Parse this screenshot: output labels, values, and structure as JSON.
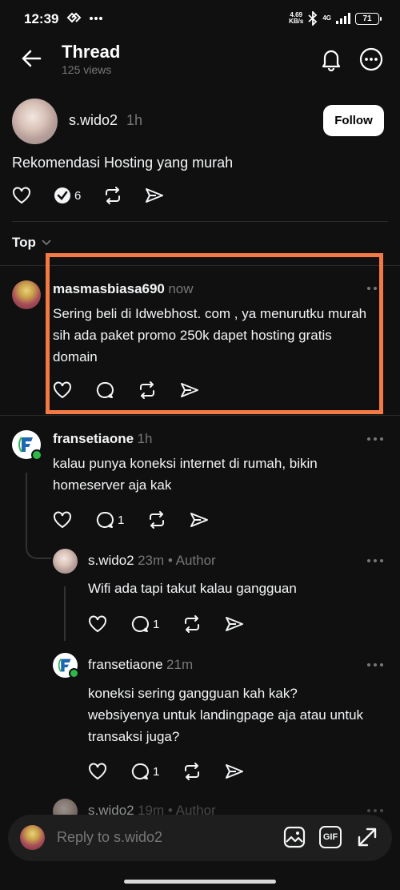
{
  "status_bar": {
    "time": "12:39",
    "net_speed_value": "4.69",
    "net_speed_unit": "KB/s",
    "network": "4G",
    "battery": "71"
  },
  "header": {
    "title": "Thread",
    "views": "125 views"
  },
  "post": {
    "username": "s.wido2",
    "time": "1h",
    "follow_label": "Follow",
    "text": "Rekomendasi Hosting yang murah",
    "reply_count": "6"
  },
  "sort": {
    "label": "Top"
  },
  "comments": [
    {
      "username": "masmasbiasa690",
      "time": "now",
      "text": "Sering beli di Idwebhost. com , ya menurutku murah sih ada paket promo 250k dapet hosting gratis domain",
      "reply_count": ""
    },
    {
      "username": "fransetiaone",
      "time": "1h",
      "text": "kalau punya koneksi internet di rumah, bikin homeserver aja kak",
      "reply_count": "1"
    },
    {
      "username": "s.wido2",
      "time": "23m • Author",
      "text": "Wifi ada tapi takut kalau gangguan",
      "reply_count": "1"
    },
    {
      "username": "fransetiaone",
      "time": "21m",
      "text": "koneksi sering gangguan kah kak? websiyenya untuk landingpage aja atau untuk transaksi juga?",
      "reply_count": "1"
    },
    {
      "username": "s.wido2",
      "time": "19m • Author"
    }
  ],
  "reply_bar": {
    "placeholder": "Reply to s.wido2",
    "gif_label": "GIF"
  },
  "colors": {
    "background": "#101010",
    "highlight": "#f47a45",
    "online": "#2fb84a"
  }
}
